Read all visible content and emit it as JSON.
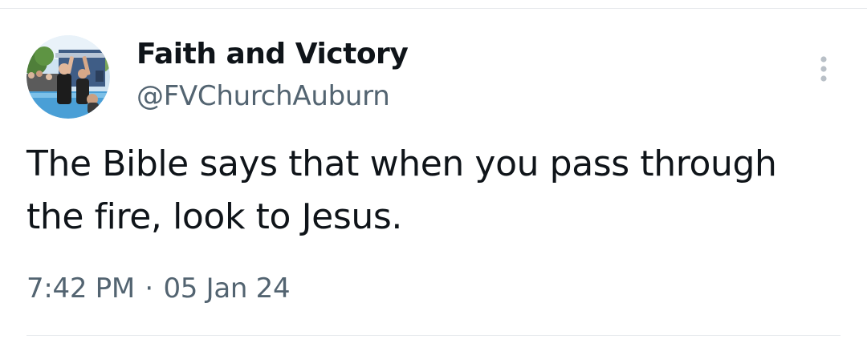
{
  "tweet": {
    "author": {
      "display_name": "Faith and Victory",
      "handle": "@FVChurchAuburn",
      "avatar_icon": "profile-photo"
    },
    "text": "The Bible says that when you pass through the fire, look to Jesus.",
    "time": "7:42 PM",
    "separator": "·",
    "date": "05 Jan 24",
    "more_icon": "more-vertical-icon"
  },
  "colors": {
    "text_primary": "#0f1419",
    "text_secondary": "#536471",
    "divider": "#e6e9ec",
    "icon_muted": "#b9c0c7"
  }
}
